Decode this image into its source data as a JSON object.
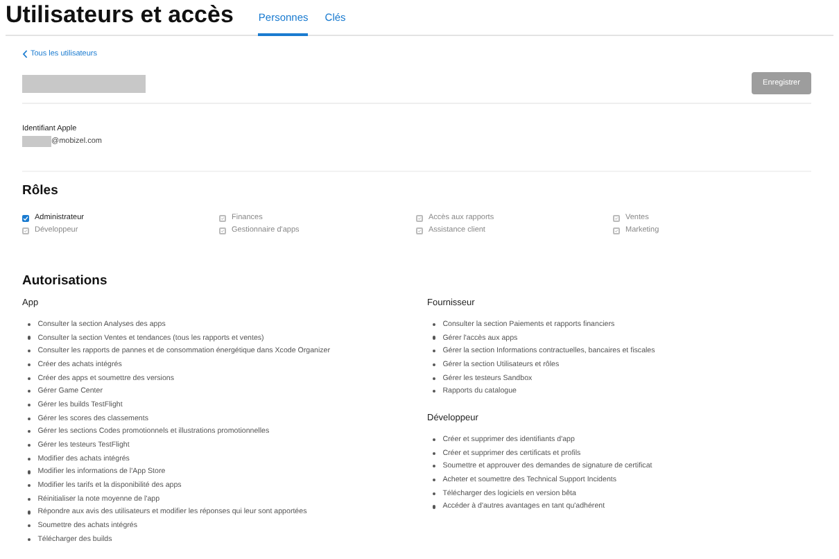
{
  "header": {
    "title": "Utilisateurs et accès",
    "tabs": [
      {
        "label": "Personnes",
        "selected": true
      },
      {
        "label": "Clés",
        "selected": false
      }
    ]
  },
  "back_link": "Tous les utilisateurs",
  "save_button": {
    "label": "Enregistrer",
    "disabled": true
  },
  "apple_id": {
    "label": "Identifiant Apple",
    "value": "@mobizel.com"
  },
  "roles": {
    "title": "Rôles",
    "items": [
      {
        "label": "Administrateur",
        "checked": true,
        "disabled": false
      },
      {
        "label": "Finances",
        "checked": true,
        "disabled": true
      },
      {
        "label": "Accès aux rapports",
        "checked": true,
        "disabled": true
      },
      {
        "label": "Ventes",
        "checked": true,
        "disabled": true
      },
      {
        "label": "Développeur",
        "checked": true,
        "disabled": true
      },
      {
        "label": "Gestionnaire d'apps",
        "checked": true,
        "disabled": true
      },
      {
        "label": "Assistance client",
        "checked": true,
        "disabled": true
      },
      {
        "label": "Marketing",
        "checked": true,
        "disabled": true
      }
    ]
  },
  "permissions": {
    "title": "Autorisations",
    "groups": [
      {
        "title": "App",
        "items": [
          "Consulter la section Analyses des apps",
          "Consulter la section Ventes et tendances (tous les rapports et ventes)",
          "Consulter les rapports de pannes et de consommation énergétique dans Xcode Organizer",
          "Créer des achats intégrés",
          "Créer des apps et soumettre des versions",
          "Gérer Game Center",
          "Gérer les builds TestFlight",
          "Gérer les scores des classements",
          "Gérer les sections Codes promotionnels et illustrations promotionnelles",
          "Gérer les testeurs TestFlight",
          "Modifier des achats intégrés",
          "Modifier les informations de l'App Store",
          "Modifier les tarifs et la disponibilité des apps",
          "Réinitialiser la note moyenne de l'app",
          "Répondre aux avis des utilisateurs et modifier les réponses qui leur sont apportées",
          "Soumettre des achats intégrés",
          "Télécharger des builds"
        ]
      },
      {
        "title": "Fournisseur",
        "items": [
          "Consulter la section Paiements et rapports financiers",
          "Gérer l'accès aux apps",
          "Gérer la section Informations contractuelles, bancaires et fiscales",
          "Gérer la section Utilisateurs et rôles",
          "Gérer les testeurs Sandbox",
          "Rapports du catalogue"
        ]
      },
      {
        "title": "Développeur",
        "items": [
          "Créer et supprimer des identifiants d'app",
          "Créer et supprimer des certificats et profils",
          "Soumettre et approuver des demandes de signature de certificat",
          "Acheter et soumettre des Technical Support Incidents",
          "Télécharger des logiciels en version bêta",
          "Accéder à d'autres avantages en tant qu'adhérent"
        ]
      }
    ]
  }
}
